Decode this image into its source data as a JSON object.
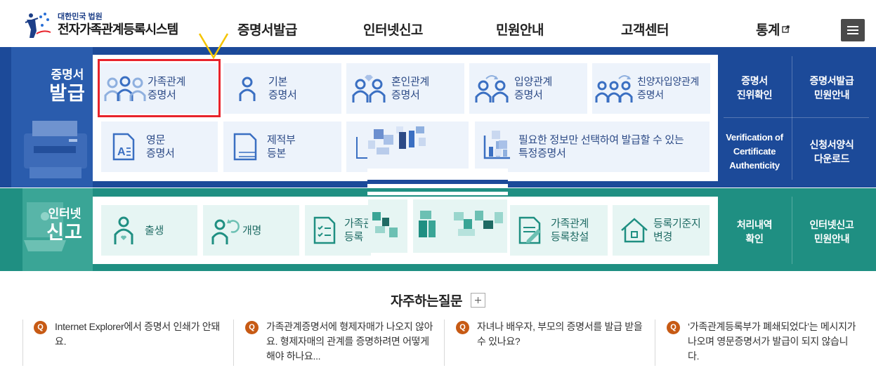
{
  "header": {
    "logo_sub": "대한민국 법원",
    "logo_main": "전자가족관계등록시스템",
    "nav": [
      {
        "label": "증명서발급"
      },
      {
        "label": "인터넷신고"
      },
      {
        "label": "민원안내"
      },
      {
        "label": "고객센터"
      },
      {
        "label": "통계"
      }
    ],
    "menu_icon": "hamburger-icon"
  },
  "issue": {
    "title_small": "증명서",
    "title_large": "발급",
    "cards": [
      {
        "label_1": "가족관계",
        "label_2": "증명서",
        "icon": "family-icon"
      },
      {
        "label_1": "기본",
        "label_2": "증명서",
        "icon": "person-icon"
      },
      {
        "label_1": "혼인관계",
        "label_2": "증명서",
        "icon": "marriage-icon"
      },
      {
        "label_1": "입양관계",
        "label_2": "증명서",
        "icon": "adoption-icon"
      },
      {
        "label_1": "친양자입양관계",
        "label_2": "증명서",
        "icon": "full-adoption-icon"
      },
      {
        "label_1": "영문",
        "label_2": "증명서",
        "icon": "english-doc-icon"
      },
      {
        "label_1": "제적부",
        "label_2": "등본",
        "icon": "removed-register-icon"
      },
      {
        "label_1": "필요한 정보만 선택하여 발급할 수 있는",
        "label_2": "특정증명서",
        "icon": "chart-doc-icon"
      }
    ],
    "side": [
      {
        "label_1": "증명서",
        "label_2": "진위확인"
      },
      {
        "label_1": "증명서발급",
        "label_2": "민원안내"
      },
      {
        "label_1": "Verification of",
        "label_2": "Certificate",
        "label_3": "Authenticity"
      },
      {
        "label_1": "신청서양식",
        "label_2": "다운로드"
      }
    ]
  },
  "report": {
    "title_small": "인터넷",
    "title_large": "신고",
    "cards": [
      {
        "label_1": "출생",
        "icon": "birth-icon"
      },
      {
        "label_1": "개명",
        "icon": "rename-icon"
      },
      {
        "label_1": "가족관",
        "label_2": "등록",
        "icon": "checklist-icon"
      },
      {
        "label_1": "가족관계",
        "label_2": "등록창설",
        "icon": "register-create-icon"
      },
      {
        "label_1": "등록기준지",
        "label_2": "변경",
        "icon": "house-icon"
      }
    ],
    "side": [
      {
        "label_1": "처리내역",
        "label_2": "확인"
      },
      {
        "label_1": "인터넷신고",
        "label_2": "민원안내"
      }
    ]
  },
  "faq": {
    "title": "자주하는질문",
    "badge": "Q",
    "items": [
      {
        "text": "Internet Explorer에서 증명서 인쇄가 안돼요."
      },
      {
        "text": "가족관계증명서에 형제자매가 나오지 않아요. 형제자매의 관계를 증명하려면 어떻게 해야 하나요..."
      },
      {
        "text": "자녀나 배우자, 부모의 증명서를 발급 받을 수 있나요?"
      },
      {
        "text": "‘가족관계등록부가 폐쇄되었다’는 메시지가 나오며 영문증명서가 발급이 되지 않습니다."
      }
    ]
  },
  "colors": {
    "blue_band": "#1c4a99",
    "teal_band": "#1f8f82",
    "highlight_red": "#e8232b",
    "annotation_yellow": "#f5c400",
    "faq_badge": "#c75a14"
  }
}
